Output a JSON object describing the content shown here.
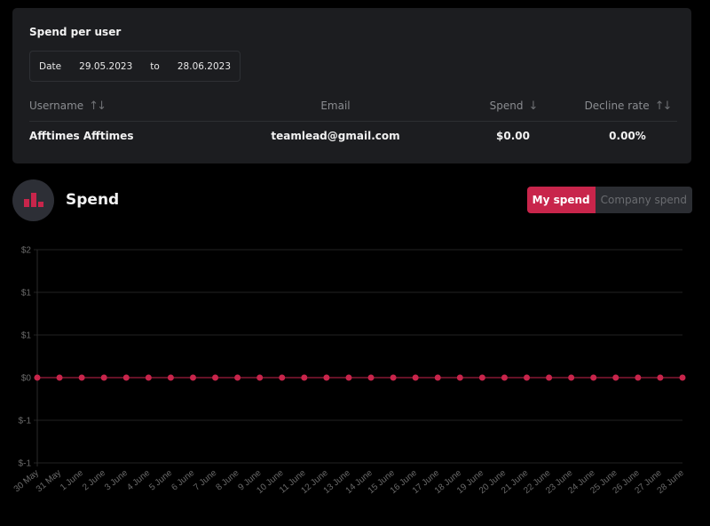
{
  "spend_per_user": {
    "title": "Spend per user",
    "date_filter": {
      "label": "Date",
      "from": "29.05.2023",
      "to_label": "to",
      "to": "28.06.2023"
    },
    "columns": [
      {
        "label": "Username",
        "sort_icon": "sort-both-icon",
        "sort_glyph": "↑↓"
      },
      {
        "label": "Email",
        "sort_icon": null,
        "sort_glyph": ""
      },
      {
        "label": "Spend",
        "sort_icon": "sort-desc-icon",
        "sort_glyph": "↓"
      },
      {
        "label": "Decline rate",
        "sort_icon": "sort-both-icon",
        "sort_glyph": "↑↓"
      }
    ],
    "rows": [
      {
        "username": "Afftimes Afftimes",
        "email": "teamlead@gmail.com",
        "spend": "$0.00",
        "decline_rate": "0.00%"
      }
    ]
  },
  "spend_section": {
    "title": "Spend",
    "icon": "bar-chart-icon",
    "toggle": {
      "options": [
        "My spend",
        "Company spend"
      ],
      "selected": "My spend"
    },
    "accent_color": "#c8254b"
  },
  "chart_data": {
    "type": "line",
    "title": "Spend",
    "xlabel": "",
    "ylabel": "",
    "categories": [
      "30 May",
      "31 May",
      "1 June",
      "2 June",
      "3 June",
      "4 June",
      "5 June",
      "6 June",
      "7 June",
      "8 June",
      "9 June",
      "10 June",
      "11 June",
      "12 June",
      "13 June",
      "14 June",
      "15 June",
      "16 June",
      "17 June",
      "18 June",
      "19 June",
      "20 June",
      "21 June",
      "22 June",
      "23 June",
      "24 June",
      "25 June",
      "26 June",
      "27 June",
      "28 June"
    ],
    "series": [
      {
        "name": "My spend",
        "color": "#c8254b",
        "values": [
          0,
          0,
          0,
          0,
          0,
          0,
          0,
          0,
          0,
          0,
          0,
          0,
          0,
          0,
          0,
          0,
          0,
          0,
          0,
          0,
          0,
          0,
          0,
          0,
          0,
          0,
          0,
          0,
          0,
          0
        ]
      }
    ],
    "y_ticks": [
      1,
      0.5,
      0,
      -0.5,
      -1
    ],
    "y_tick_labels": [
      "$2",
      "$1",
      "$1",
      "$0",
      "$-1",
      "$-1"
    ],
    "ylim": [
      -1,
      1
    ],
    "grid": true,
    "legend": "none"
  }
}
